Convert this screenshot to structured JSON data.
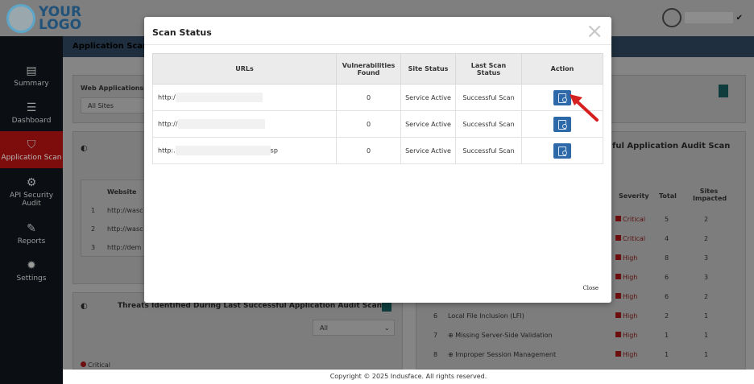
{
  "logo": {
    "line1": "YOUR",
    "line2": "LOGO"
  },
  "sidebar": {
    "items": [
      {
        "label": "Summary",
        "icon": "summary-icon"
      },
      {
        "label": "Dashboard",
        "icon": "dashboard-icon"
      },
      {
        "label": "Application Scan",
        "icon": "shield-icon"
      },
      {
        "label": "API Security Audit",
        "icon": "api-icon"
      },
      {
        "label": "Reports",
        "icon": "edit-icon"
      },
      {
        "label": "Settings",
        "icon": "gear-icon"
      }
    ]
  },
  "page": {
    "title": "Application Scan"
  },
  "background": {
    "web_apps_label": "Web Applications",
    "web_apps_value": "All Sites",
    "website_header": "Website",
    "websites": [
      {
        "num": "1",
        "url": "http://wasc"
      },
      {
        "num": "2",
        "url": "http://wasc"
      },
      {
        "num": "3",
        "url": "http://dem"
      }
    ],
    "threats_title": "Threats Identified During Last Successful Application Audit Scan",
    "threats_filter": "All",
    "critical_legend": "Critical",
    "audit_title": "ful Application Audit Scan",
    "vuln_headers": {
      "severity": "Severity",
      "total": "Total",
      "sites": "Sites Impacted"
    },
    "vulns": [
      {
        "severity": "Critical",
        "total": "5",
        "sites": "2"
      },
      {
        "severity": "Critical",
        "total": "4",
        "sites": "2"
      },
      {
        "severity": "High",
        "total": "8",
        "sites": "3"
      },
      {
        "severity": "High",
        "total": "6",
        "sites": "3"
      },
      {
        "severity": "High",
        "total": "6",
        "sites": "2"
      },
      {
        "num": "6",
        "name": "Local File Inclusion (LFI)",
        "severity": "High",
        "total": "2",
        "sites": "1"
      },
      {
        "num": "7",
        "name": "Missing Server-Side Validation",
        "severity": "High",
        "total": "1",
        "sites": "1"
      },
      {
        "num": "8",
        "name": "Improper Session Management",
        "severity": "High",
        "total": "1",
        "sites": "1"
      }
    ]
  },
  "modal": {
    "title": "Scan Status",
    "close_label": "Close",
    "columns": [
      "URLs",
      "Vulnerabilities Found",
      "Site Status",
      "Last Scan Status",
      "Action"
    ],
    "rows": [
      {
        "url": "http:/",
        "url_suffix": "",
        "vulns": "0",
        "site_status": "Service Active",
        "scan_status": "Successful Scan"
      },
      {
        "url": "http://",
        "url_suffix": "",
        "vulns": "0",
        "site_status": "Service Active",
        "scan_status": "Successful Scan"
      },
      {
        "url": "http:.",
        "url_suffix": "sp",
        "vulns": "0",
        "site_status": "Service Active",
        "scan_status": "Successful Scan"
      }
    ]
  },
  "footer": {
    "text": "Copyright © 2025 Indusface. All rights reserved."
  },
  "colors": {
    "accent": "#2d68a8",
    "sidebar_active": "#b01414",
    "arrow": "#d61f1f"
  }
}
